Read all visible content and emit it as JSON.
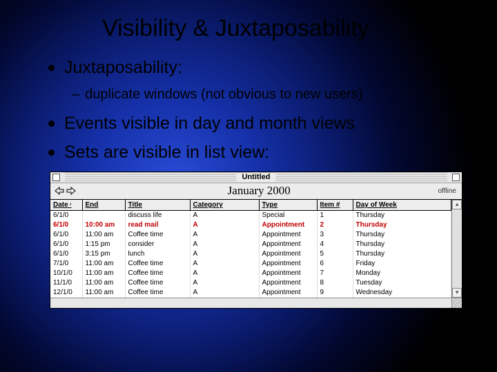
{
  "slide": {
    "title": "Visibility & Juxtaposability",
    "bullets": [
      {
        "text": "Juxtaposability:",
        "sub": "duplicate windows (not obvious to new users)"
      },
      {
        "text": "Events visible in day and month views"
      },
      {
        "text": "Sets are visible in list view:"
      }
    ]
  },
  "window": {
    "title": "Untitled",
    "month": "January 2000",
    "status_right": "offline",
    "columns": [
      "Date",
      "End",
      "Title",
      "Category",
      "Type",
      "Item #",
      "Day of Week"
    ],
    "sort_column": "Date",
    "rows": [
      {
        "date": "6/1/0",
        "end": "",
        "title": "discuss life",
        "category": "A",
        "type": "Special",
        "item": "1",
        "dow": "Thursday",
        "hl": false
      },
      {
        "date": "6/1/0",
        "end": "10:00 am",
        "title": "read mail",
        "category": "A",
        "type": "Appointment",
        "item": "2",
        "dow": "Thursday",
        "hl": true
      },
      {
        "date": "6/1/0",
        "end": "11:00 am",
        "title": "Coffee time",
        "category": "A",
        "type": "Appointment",
        "item": "3",
        "dow": "Thursday",
        "hl": false
      },
      {
        "date": "6/1/0",
        "end": "1:15 pm",
        "title": "consider",
        "category": "A",
        "type": "Appointment",
        "item": "4",
        "dow": "Thursday",
        "hl": false
      },
      {
        "date": "6/1/0",
        "end": "3:15 pm",
        "title": "lunch",
        "category": "A",
        "type": "Appointment",
        "item": "5",
        "dow": "Thursday",
        "hl": false
      },
      {
        "date": "7/1/0",
        "end": "11:00 am",
        "title": "Coffee time",
        "category": "A",
        "type": "Appointment",
        "item": "6",
        "dow": "Friday",
        "hl": false
      },
      {
        "date": "10/1/0",
        "end": "11:00 am",
        "title": "Coffee time",
        "category": "A",
        "type": "Appointment",
        "item": "7",
        "dow": "Monday",
        "hl": false
      },
      {
        "date": "11/1/0",
        "end": "11:00 am",
        "title": "Coffee time",
        "category": "A",
        "type": "Appointment",
        "item": "8",
        "dow": "Tuesday",
        "hl": false
      },
      {
        "date": "12/1/0",
        "end": "11:00 am",
        "title": "Coffee time",
        "category": "A",
        "type": "Appointment",
        "item": "9",
        "dow": "Wednesday",
        "hl": false
      }
    ]
  }
}
